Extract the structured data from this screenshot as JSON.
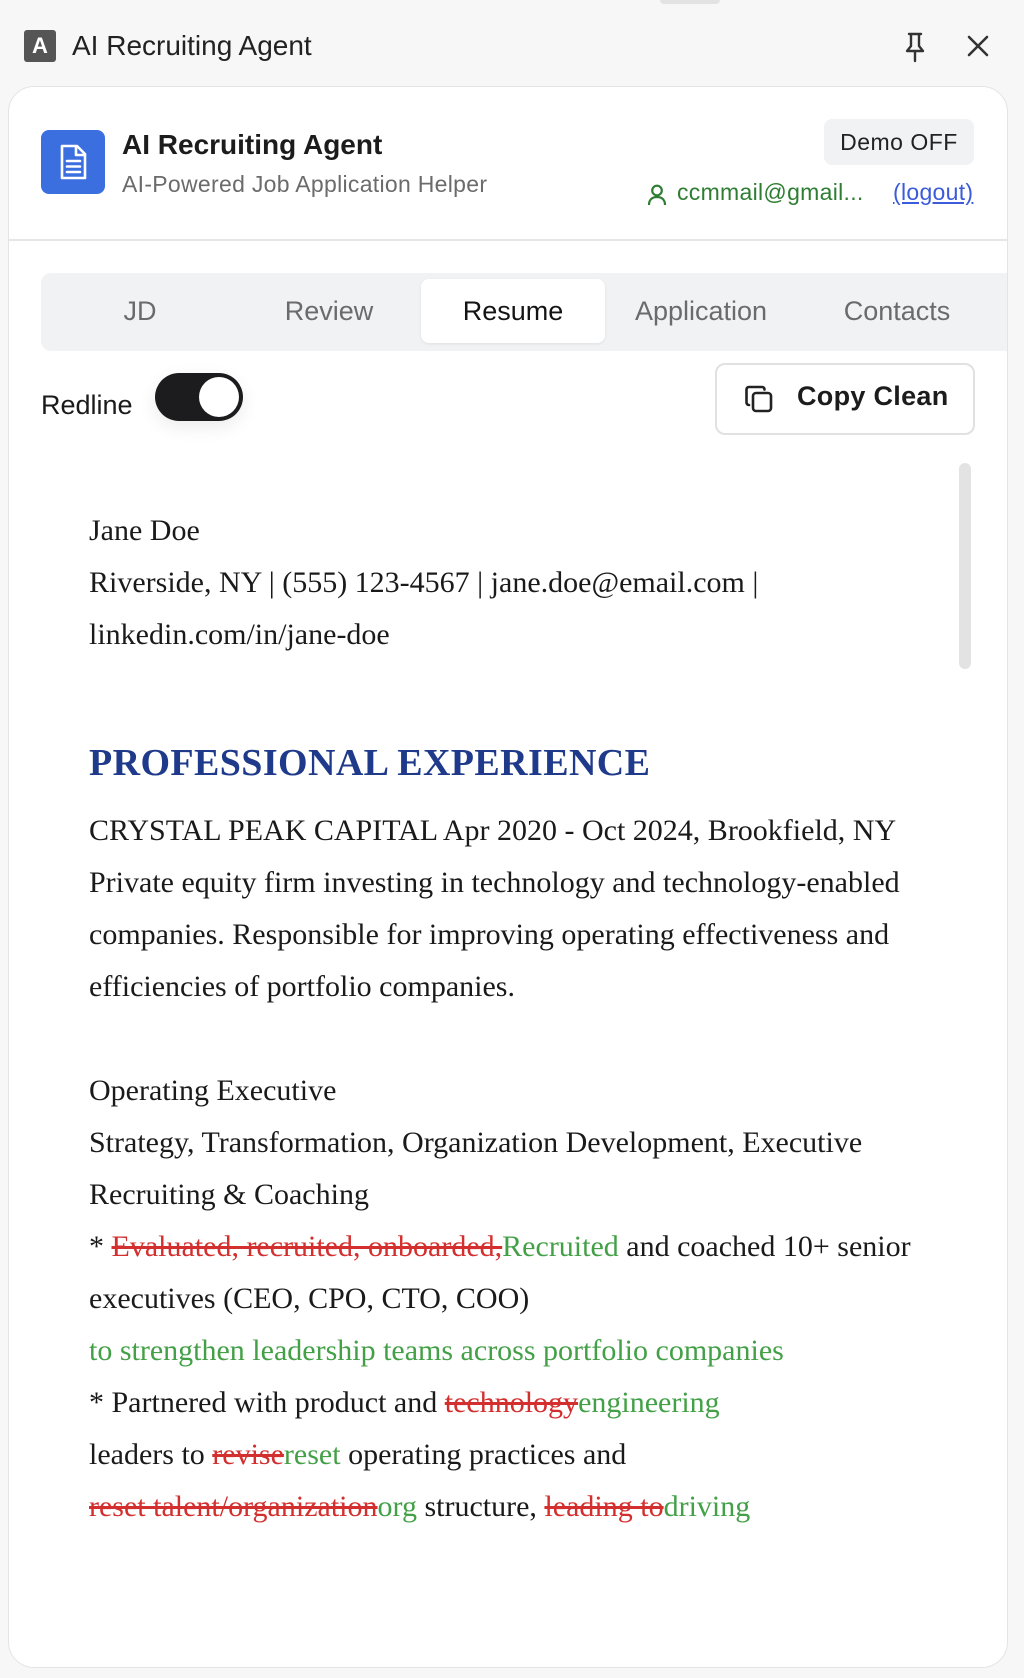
{
  "window": {
    "badge": "A",
    "title": "AI Recruiting Agent"
  },
  "header": {
    "title": "AI Recruiting Agent",
    "subtitle": "AI-Powered Job Application Helper",
    "demo_button": "Demo OFF",
    "user_email": "ccmmail@gmail...",
    "logout": "(logout)"
  },
  "tabs": [
    {
      "label": "JD"
    },
    {
      "label": "Review"
    },
    {
      "label": "Resume"
    },
    {
      "label": "Application"
    },
    {
      "label": "Contacts"
    }
  ],
  "active_tab": "Resume",
  "controls": {
    "redline_label": "Redline",
    "redline_on": true,
    "copy_button": "Copy Clean"
  },
  "resume": {
    "name": "Jane Doe",
    "contact_line1": "Riverside, NY | (555) 123-4567 | jane.doe@email.com |",
    "contact_line2": "linkedin.com/in/jane-doe",
    "section_heading": "PROFESSIONAL EXPERIENCE",
    "company_line": "CRYSTAL PEAK CAPITAL Apr 2020 - Oct 2024, Brookfield, NY",
    "company_desc": "Private equity firm investing in technology and technology-enabled companies. Responsible for improving operating effectiveness and efficiencies of portfolio companies.",
    "role_title": "Operating Executive",
    "role_areas": "Strategy, Transformation, Organization Development, Executive Recruiting & Coaching",
    "bullet1": {
      "prefix": "* ",
      "del1": "Evaluated, recruited, onboarded,",
      "ins1": "Recruited",
      "text1": " and coached 10+ senior executives (CEO, CPO, CTO, COO)",
      "ins2": "to strengthen leadership teams across portfolio companies"
    },
    "bullet2": {
      "prefix": "* Partnered with product and ",
      "del1": "technology",
      "ins1": "engineering",
      "text1": " leaders to ",
      "del2": "revise",
      "ins2": "reset",
      "text2": " operating practices and ",
      "del3": "reset talent/organization",
      "ins3": "org",
      "text3": " structure, ",
      "del4": "leading to",
      "ins4": "driving"
    }
  }
}
